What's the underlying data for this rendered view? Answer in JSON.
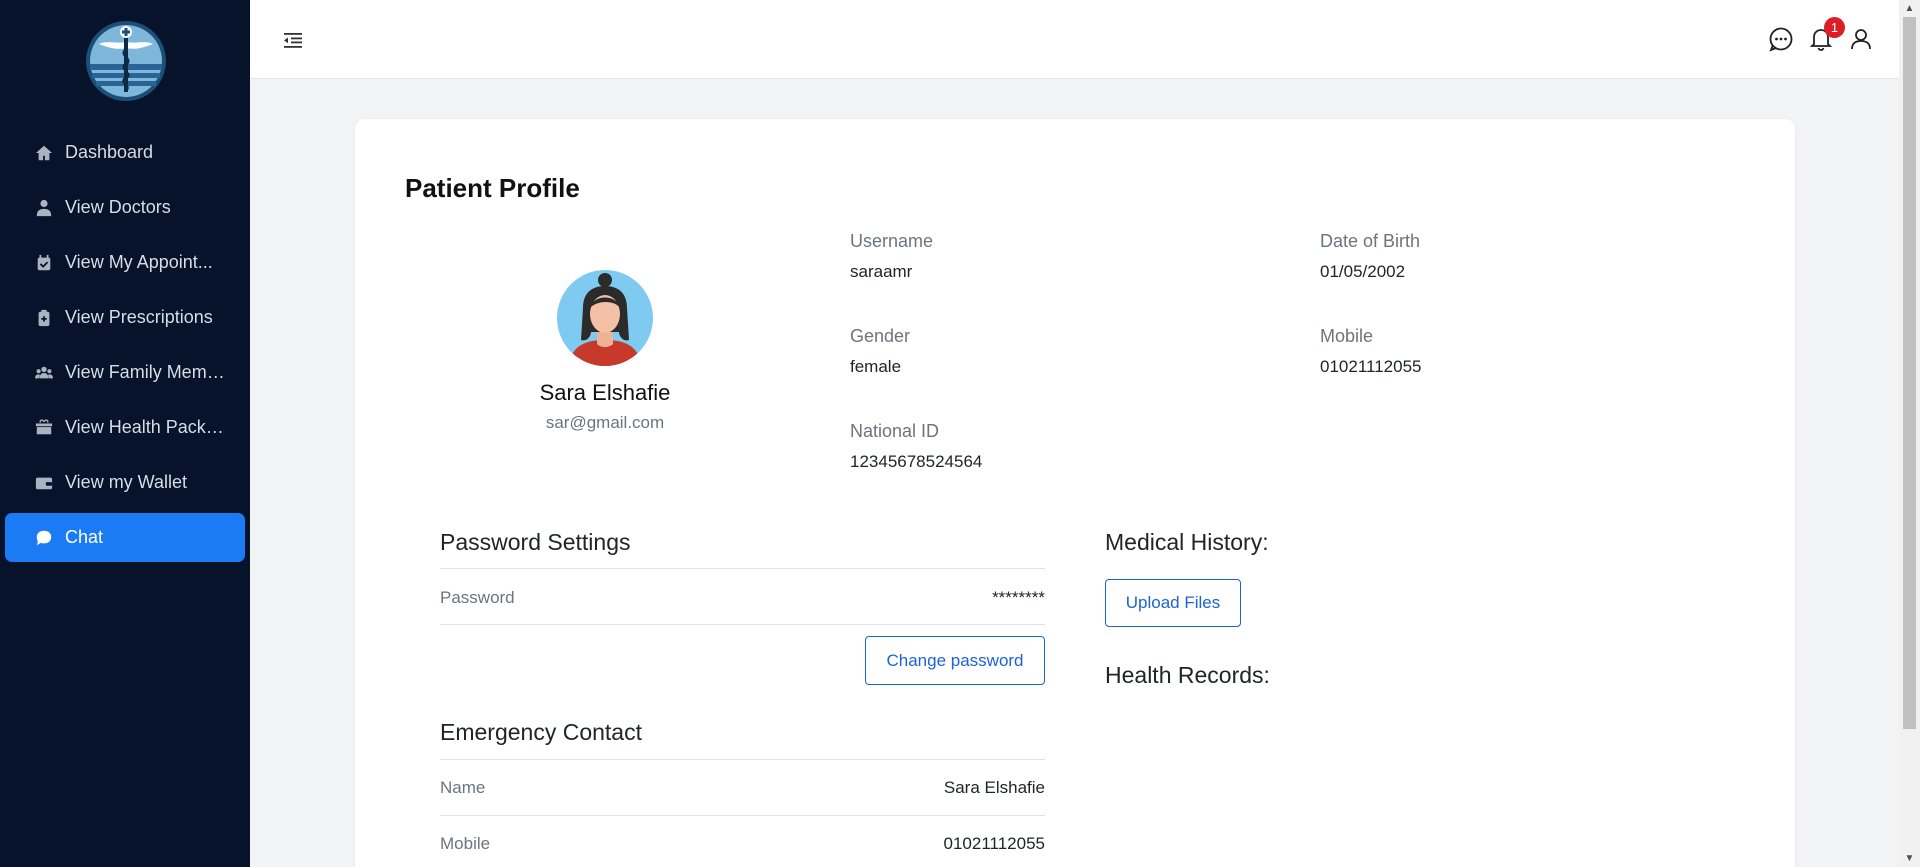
{
  "sidebar": {
    "items": [
      {
        "label": "Dashboard",
        "icon": "home-icon"
      },
      {
        "label": "View Doctors",
        "icon": "doctor-icon"
      },
      {
        "label": "View My Appoint...",
        "icon": "calendar-check-icon"
      },
      {
        "label": "View Prescriptions",
        "icon": "clipboard-medical-icon"
      },
      {
        "label": "View Family Memb...",
        "icon": "users-icon"
      },
      {
        "label": "View Health Packa...",
        "icon": "box-heart-icon"
      },
      {
        "label": "View my Wallet",
        "icon": "wallet-icon"
      },
      {
        "label": "Chat",
        "icon": "chat-bubble-icon",
        "active": true
      }
    ]
  },
  "topbar": {
    "notification_count": "1"
  },
  "profile": {
    "title": "Patient Profile",
    "name": "Sara Elshafie",
    "email": "sar@gmail.com",
    "fields": {
      "username_label": "Username",
      "username_value": "saraamr",
      "dob_label": "Date of Birth",
      "dob_value": "01/05/2002",
      "gender_label": "Gender",
      "gender_value": "female",
      "mobile_label": "Mobile",
      "mobile_value": "01021112055",
      "national_id_label": "National ID",
      "national_id_value": "12345678524564"
    }
  },
  "password_settings": {
    "title": "Password Settings",
    "password_label": "Password",
    "password_value": "********",
    "change_button": "Change password"
  },
  "emergency_contact": {
    "title": "Emergency Contact",
    "name_label": "Name",
    "name_value": "Sara Elshafie",
    "mobile_label": "Mobile",
    "mobile_value": "01021112055"
  },
  "medical": {
    "history_title": "Medical History:",
    "upload_button": "Upload Files",
    "records_title": "Health Records:"
  },
  "colors": {
    "sidebar_bg": "#06132b",
    "accent": "#1b7bf5",
    "badge": "#dc1f26"
  }
}
